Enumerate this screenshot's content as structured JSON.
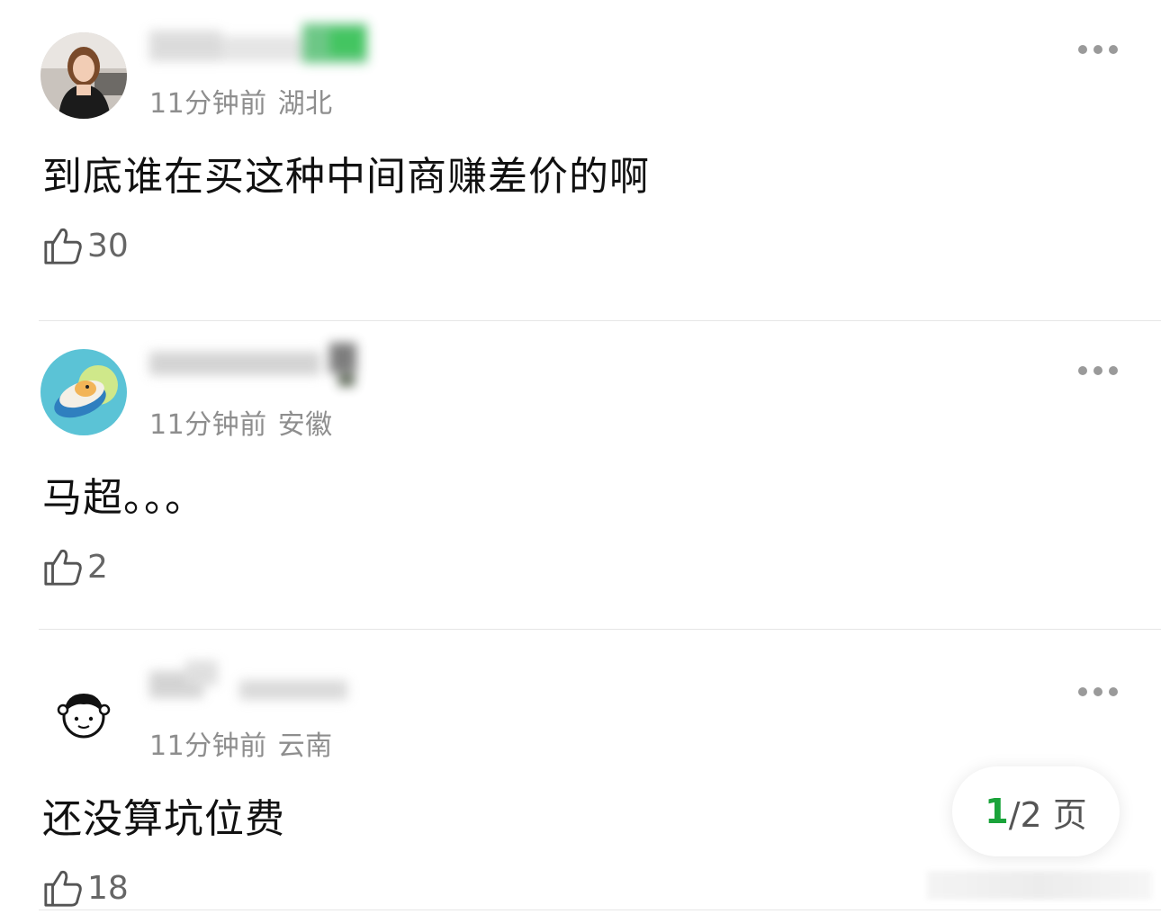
{
  "comments": [
    {
      "time": "11分钟前",
      "location": "湖北",
      "text": "到底谁在买这种中间商赚差价的啊",
      "likes": "30",
      "avatar_icon": "girl-photo-avatar"
    },
    {
      "time": "11分钟前",
      "location": "安徽",
      "text": "马超。。。",
      "likes": "2",
      "avatar_icon": "cartoon-capybara-avatar"
    },
    {
      "time": "11分钟前",
      "location": "云南",
      "text": "还没算坑位费",
      "likes": "18",
      "avatar_icon": "cartoon-girl-face-avatar"
    }
  ],
  "pager": {
    "current": "1",
    "rest": "/2 页"
  },
  "colors": {
    "accent": "#1aa33a",
    "meta": "#8e8e8e",
    "divider": "#e6e6e6"
  }
}
